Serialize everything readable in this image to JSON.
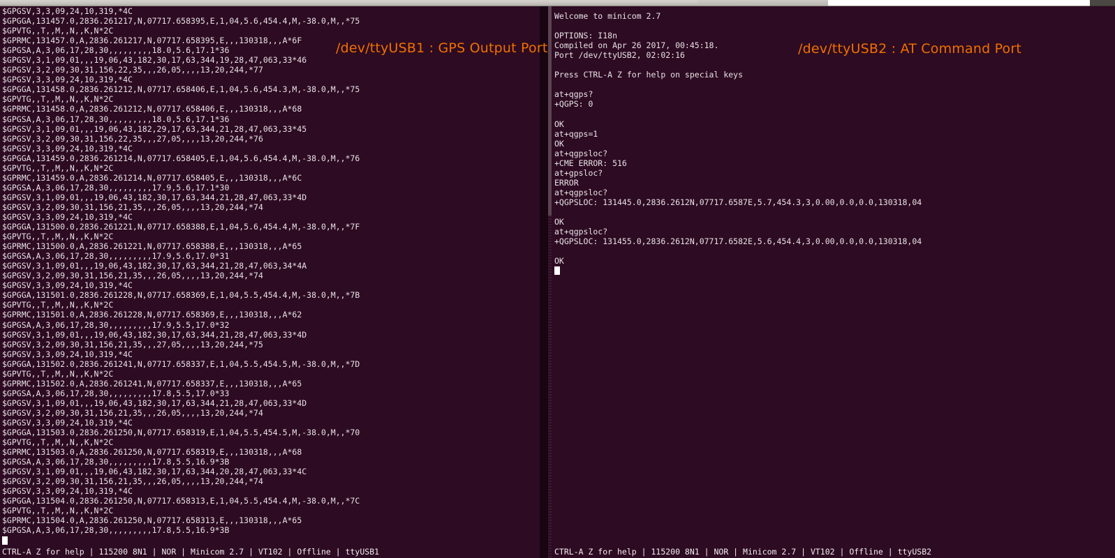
{
  "window": {
    "title_bar_present": true
  },
  "annotations": [
    {
      "id": "gps-output-port-label",
      "text": "/dev/ttyUSB1 : GPS Output Port",
      "color": "#f07000"
    },
    {
      "id": "at-command-port-label",
      "text": "/dev/ttyUSB2 : AT Command Port",
      "color": "#f07000"
    }
  ],
  "left_terminal": {
    "name": "minicom-gps-output",
    "device": "/dev/ttyUSB1",
    "status_bar": "CTRL-A Z for help | 115200 8N1 | NOR | Minicom 2.7 | VT102 | Offline | ttyUSB1",
    "cursor_visible": true,
    "lines": [
      "$GPGSV,3,3,09,24,10,319,*4C",
      "$GPGGA,131457.0,2836.261217,N,07717.658395,E,1,04,5.6,454.4,M,-38.0,M,,*75",
      "$GPVTG,,T,,M,,N,,K,N*2C",
      "$GPRMC,131457.0,A,2836.261217,N,07717.658395,E,,,130318,,,A*6F",
      "$GPGSA,A,3,06,17,28,30,,,,,,,,,18.0,5.6,17.1*36",
      "$GPGSV,3,1,09,01,,,19,06,43,182,30,17,63,344,19,28,47,063,33*46",
      "$GPGSV,3,2,09,30,31,156,22,35,,,26,05,,,,13,20,244,*77",
      "$GPGSV,3,3,09,24,10,319,*4C",
      "$GPGGA,131458.0,2836.261212,N,07717.658406,E,1,04,5.6,454.3,M,-38.0,M,,*75",
      "$GPVTG,,T,,M,,N,,K,N*2C",
      "$GPRMC,131458.0,A,2836.261212,N,07717.658406,E,,,130318,,,A*68",
      "$GPGSA,A,3,06,17,28,30,,,,,,,,,18.0,5.6,17.1*36",
      "$GPGSV,3,1,09,01,,,19,06,43,182,29,17,63,344,21,28,47,063,33*45",
      "$GPGSV,3,2,09,30,31,156,22,35,,,27,05,,,,13,20,244,*76",
      "$GPGSV,3,3,09,24,10,319,*4C",
      "$GPGGA,131459.0,2836.261214,N,07717.658405,E,1,04,5.6,454.4,M,-38.0,M,,*76",
      "$GPVTG,,T,,M,,N,,K,N*2C",
      "$GPRMC,131459.0,A,2836.261214,N,07717.658405,E,,,130318,,,A*6C",
      "$GPGSA,A,3,06,17,28,30,,,,,,,,,17.9,5.6,17.1*30",
      "$GPGSV,3,1,09,01,,,19,06,43,182,30,17,63,344,21,28,47,063,33*4D",
      "$GPGSV,3,2,09,30,31,156,21,35,,,26,05,,,,13,20,244,*74",
      "$GPGSV,3,3,09,24,10,319,*4C",
      "$GPGGA,131500.0,2836.261221,N,07717.658388,E,1,04,5.6,454.4,M,-38.0,M,,*7F",
      "$GPVTG,,T,,M,,N,,K,N*2C",
      "$GPRMC,131500.0,A,2836.261221,N,07717.658388,E,,,130318,,,A*65",
      "$GPGSA,A,3,06,17,28,30,,,,,,,,,17.9,5.6,17.0*31",
      "$GPGSV,3,1,09,01,,,19,06,43,182,30,17,63,344,21,28,47,063,34*4A",
      "$GPGSV,3,2,09,30,31,156,21,35,,,26,05,,,,13,20,244,*74",
      "$GPGSV,3,3,09,24,10,319,*4C",
      "$GPGGA,131501.0,2836.261228,N,07717.658369,E,1,04,5.5,454.4,M,-38.0,M,,*7B",
      "$GPVTG,,T,,M,,N,,K,N*2C",
      "$GPRMC,131501.0,A,2836.261228,N,07717.658369,E,,,130318,,,A*62",
      "$GPGSA,A,3,06,17,28,30,,,,,,,,,17.9,5.5,17.0*32",
      "$GPGSV,3,1,09,01,,,19,06,43,182,30,17,63,344,21,28,47,063,33*4D",
      "$GPGSV,3,2,09,30,31,156,21,35,,,27,05,,,,13,20,244,*75",
      "$GPGSV,3,3,09,24,10,319,*4C",
      "$GPGGA,131502.0,2836.261241,N,07717.658337,E,1,04,5.5,454.5,M,-38.0,M,,*7D",
      "$GPVTG,,T,,M,,N,,K,N*2C",
      "$GPRMC,131502.0,A,2836.261241,N,07717.658337,E,,,130318,,,A*65",
      "$GPGSA,A,3,06,17,28,30,,,,,,,,,17.8,5.5,17.0*33",
      "$GPGSV,3,1,09,01,,,19,06,43,182,30,17,63,344,21,28,47,063,33*4D",
      "$GPGSV,3,2,09,30,31,156,21,35,,,26,05,,,,13,20,244,*74",
      "$GPGSV,3,3,09,24,10,319,*4C",
      "$GPGGA,131503.0,2836.261250,N,07717.658319,E,1,04,5.5,454.5,M,-38.0,M,,*70",
      "$GPVTG,,T,,M,,N,,K,N*2C",
      "$GPRMC,131503.0,A,2836.261250,N,07717.658319,E,,,130318,,,A*68",
      "$GPGSA,A,3,06,17,28,30,,,,,,,,,17.8,5.5,16.9*3B",
      "$GPGSV,3,1,09,01,,,19,06,43,182,30,17,63,344,20,28,47,063,33*4C",
      "$GPGSV,3,2,09,30,31,156,21,35,,,26,05,,,,13,20,244,*74",
      "$GPGSV,3,3,09,24,10,319,*4C",
      "$GPGGA,131504.0,2836.261250,N,07717.658313,E,1,04,5.5,454.4,M,-38.0,M,,*7C",
      "$GPVTG,,T,,M,,N,,K,N*2C",
      "$GPRMC,131504.0,A,2836.261250,N,07717.658313,E,,,130318,,,A*65",
      "$GPGSA,A,3,06,17,28,30,,,,,,,,,17.8,5.5,16.9*3B"
    ]
  },
  "right_terminal": {
    "name": "minicom-at-command",
    "device": "/dev/ttyUSB2",
    "status_bar": "CTRL-A Z for help | 115200 8N1 | NOR | Minicom 2.7 | VT102 | Offline | ttyUSB2",
    "cursor_visible": true,
    "lines": [
      "Welcome to minicom 2.7",
      "",
      "OPTIONS: I18n",
      "Compiled on Apr 26 2017, 00:45:18.",
      "Port /dev/ttyUSB2, 02:02:16",
      "",
      "Press CTRL-A Z for help on special keys",
      "",
      "at+qgps?",
      "+QGPS: 0",
      "",
      "OK",
      "at+qgps=1",
      "OK",
      "at+qgpsloc?",
      "+CME ERROR: 516",
      "at+gpsloc?",
      "ERROR",
      "at+qgpsloc?",
      "+QGPSLOC: 131445.0,2836.2612N,07717.6587E,5.7,454.3,3,0.00,0.0,0.0,130318,04",
      "",
      "OK",
      "at+qgpsloc?",
      "+QGPSLOC: 131455.0,2836.2612N,07717.6582E,5.6,454.4,3,0.00,0.0,0.0,130318,04",
      "",
      "OK"
    ]
  },
  "colors": {
    "terminal_background": "#2d0b22",
    "terminal_foreground": "#e8e2e6",
    "annotation": "#f07000",
    "cursor": "#ffffff"
  }
}
